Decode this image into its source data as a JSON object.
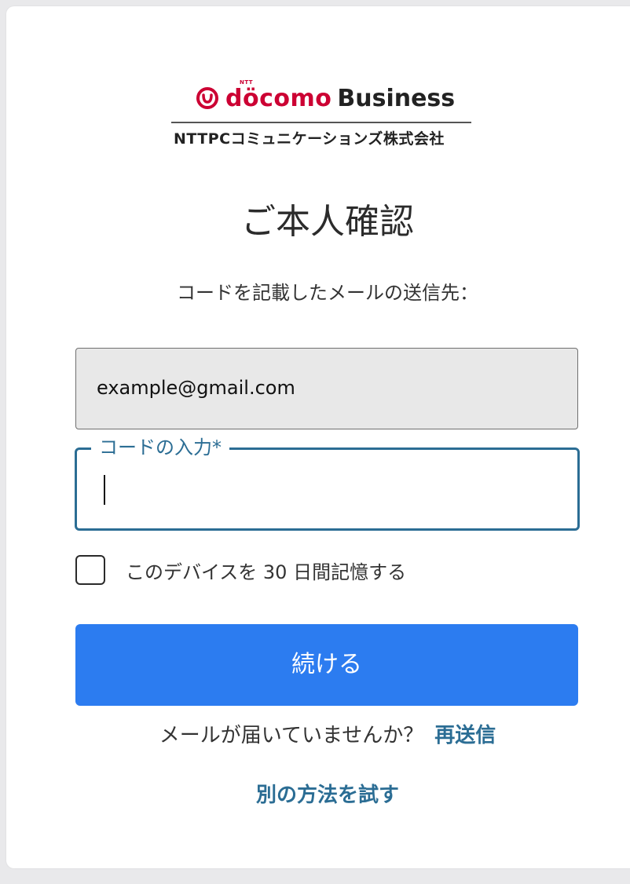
{
  "brand": {
    "ntt_small": "NTT",
    "docomo": "döcomo",
    "business": "Business",
    "company": "NTTPCコミュニケーションズ株式会社",
    "docomo_color": "#cc0033"
  },
  "page": {
    "title": "ご本人確認",
    "subtitle": "コードを記載したメールの送信先："
  },
  "email_field": {
    "value": "example@gmail.com"
  },
  "code_field": {
    "label": "コードの入力*",
    "value": ""
  },
  "remember": {
    "label": "このデバイスを 30 日間記憶する",
    "checked": false
  },
  "continue_button": {
    "label": "続ける",
    "color": "#2c7cf0"
  },
  "resend": {
    "prompt": "メールが届いていませんか？",
    "link": "再送信"
  },
  "alternative": {
    "link": "別の方法を試す"
  },
  "colors": {
    "link": "#2b6d94",
    "focus_border": "#2b6d94"
  }
}
